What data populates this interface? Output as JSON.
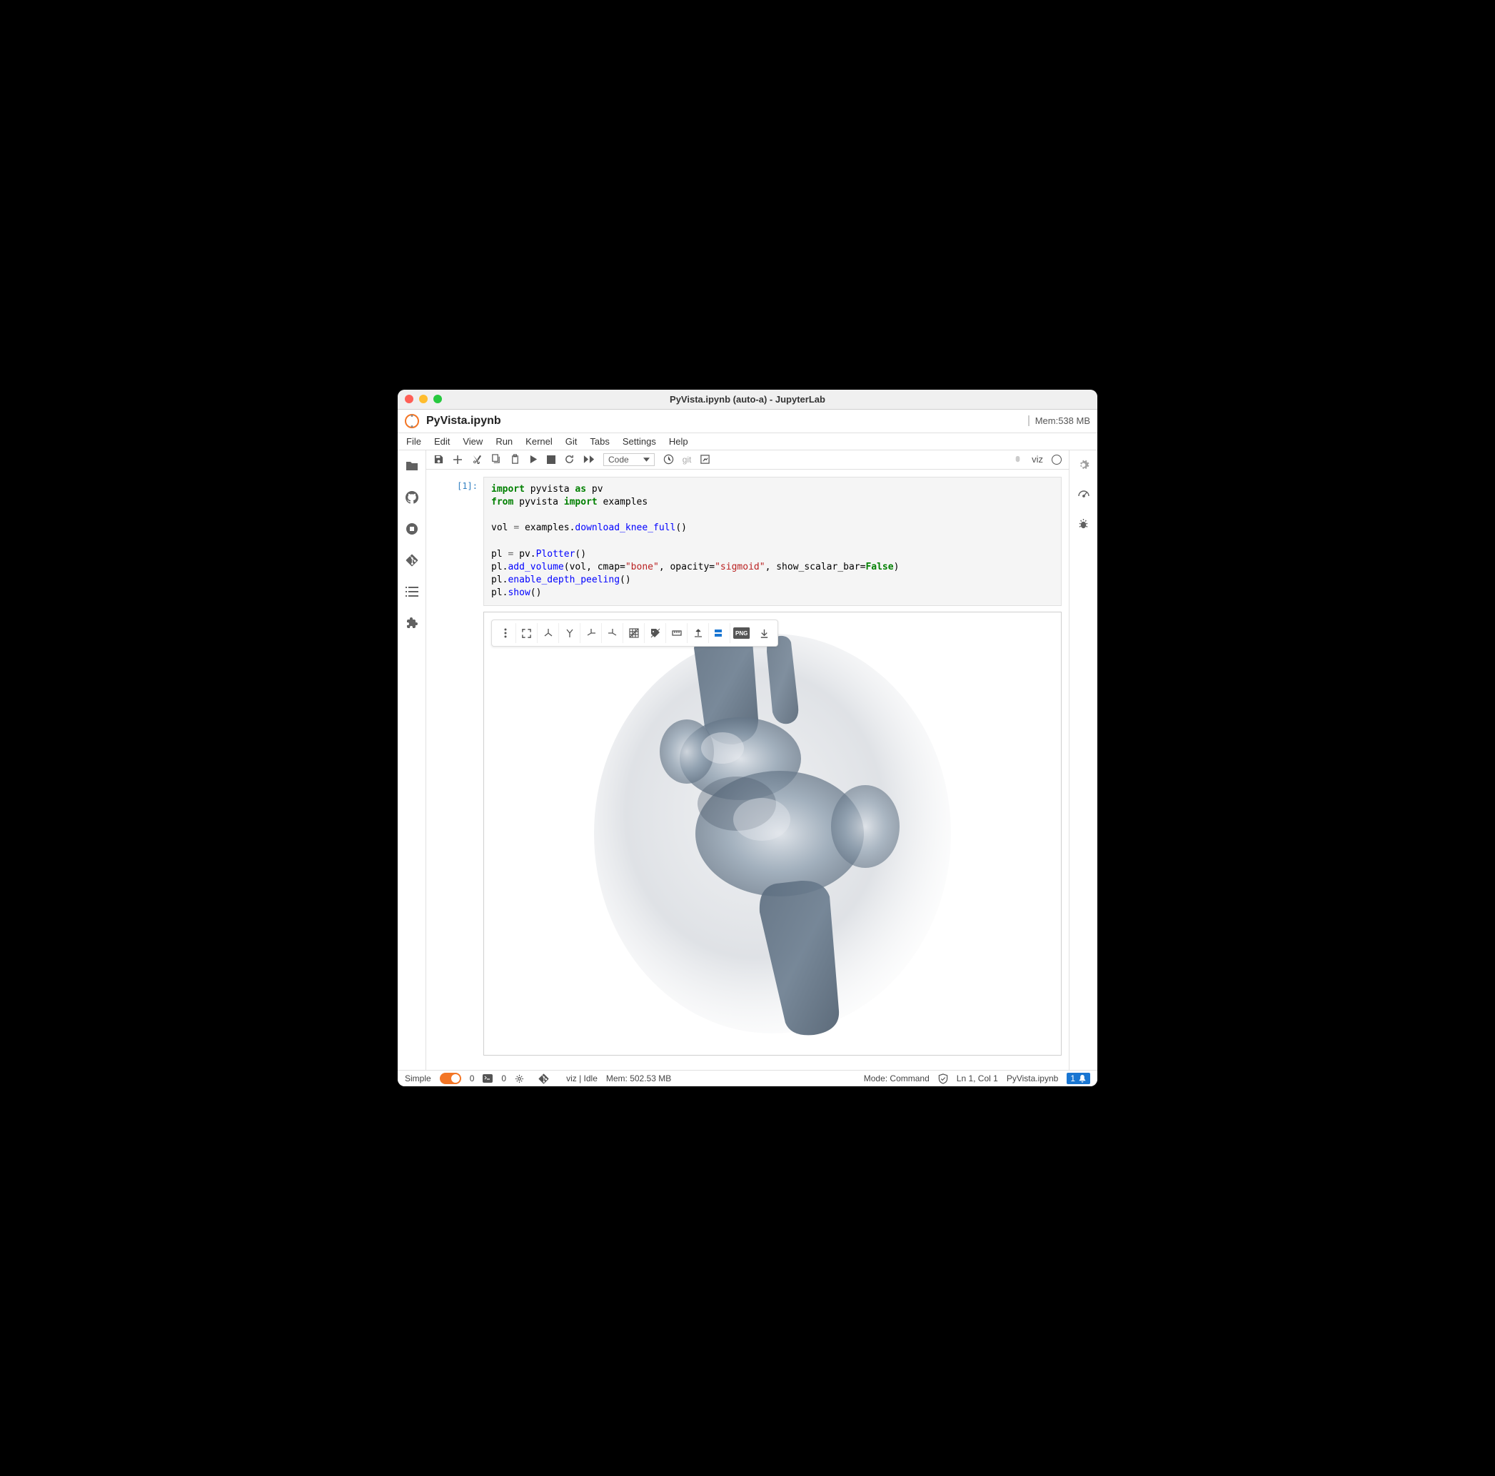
{
  "window": {
    "title": "PyVista.ipynb (auto-a) - JupyterLab"
  },
  "header": {
    "doc_title": "PyVista.ipynb",
    "mem": "Mem:538 MB"
  },
  "menubar": [
    "File",
    "Edit",
    "View",
    "Run",
    "Kernel",
    "Git",
    "Tabs",
    "Settings",
    "Help"
  ],
  "toolbar": {
    "celltype": "Code",
    "git_label": "git",
    "kernel_name": "viz"
  },
  "cell": {
    "prompt": "[1]:",
    "code": {
      "l1_import": "import",
      "l1_pyvista": " pyvista ",
      "l1_as": "as",
      "l1_pv": " pv",
      "l2_from": "from",
      "l2_pyvista": " pyvista ",
      "l2_import": "import",
      "l2_examples": " examples",
      "l4_a": "vol ",
      "l4_eq": "=",
      "l4_b": " examples.",
      "l4_fn": "download_knee_full",
      "l4_c": "()",
      "l6_a": "pl ",
      "l6_eq": "=",
      "l6_b": " pv.",
      "l6_fn": "Plotter",
      "l6_c": "()",
      "l7_a": "pl.",
      "l7_fn": "add_volume",
      "l7_b": "(vol, cmap=",
      "l7_s1": "\"bone\"",
      "l7_c": ", opacity=",
      "l7_s2": "\"sigmoid\"",
      "l7_d": ", show_scalar_bar=",
      "l7_bool": "False",
      "l7_e": ")",
      "l8_a": "pl.",
      "l8_fn": "enable_depth_peeling",
      "l8_b": "()",
      "l9_a": "pl.",
      "l9_fn": "show",
      "l9_b": "()"
    }
  },
  "viewer_toolbar": {
    "png_label": "PNG"
  },
  "statusbar": {
    "simple": "Simple",
    "count1": "0",
    "count2": "0",
    "kernel": "viz | Idle",
    "mem": "Mem: 502.53 MB",
    "mode": "Mode: Command",
    "pos": "Ln 1, Col 1",
    "file": "PyVista.ipynb",
    "notif": "1"
  }
}
